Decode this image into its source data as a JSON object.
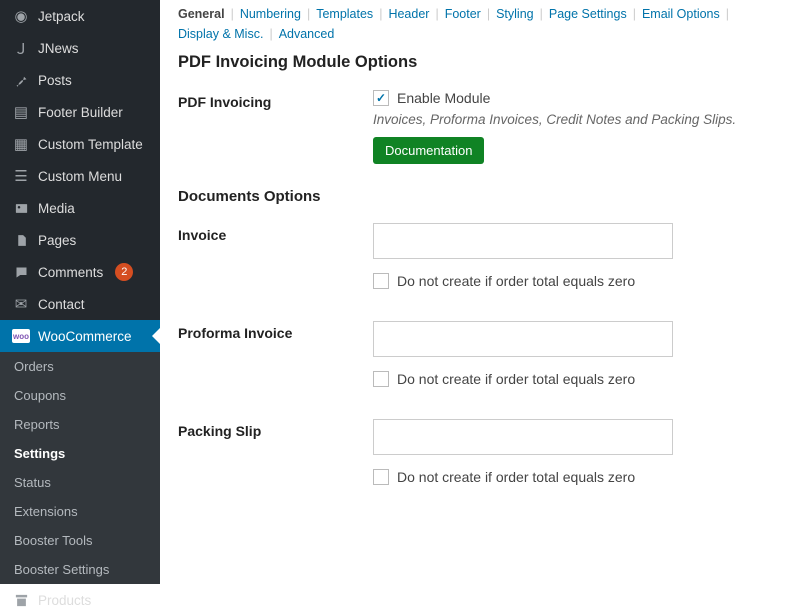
{
  "sidebar": {
    "items": [
      {
        "label": "Jetpack"
      },
      {
        "label": "JNews"
      },
      {
        "label": "Posts"
      },
      {
        "label": "Footer Builder"
      },
      {
        "label": "Custom Template"
      },
      {
        "label": "Custom Menu"
      },
      {
        "label": "Media"
      },
      {
        "label": "Pages"
      },
      {
        "label": "Comments",
        "badge": "2"
      },
      {
        "label": "Contact"
      },
      {
        "label": "WooCommerce"
      },
      {
        "label": "Products"
      }
    ],
    "sub": [
      {
        "label": "Orders"
      },
      {
        "label": "Coupons"
      },
      {
        "label": "Reports"
      },
      {
        "label": "Settings"
      },
      {
        "label": "Status"
      },
      {
        "label": "Extensions"
      },
      {
        "label": "Booster Tools"
      },
      {
        "label": "Booster Settings"
      }
    ]
  },
  "tabs": [
    "General",
    "Numbering",
    "Templates",
    "Header",
    "Footer",
    "Styling",
    "Page Settings",
    "Email Options",
    "Display & Misc.",
    "Advanced"
  ],
  "page": {
    "heading": "PDF Invoicing Module Options",
    "pdf_label": "PDF Invoicing",
    "enable_label": "Enable Module",
    "enable_checked": true,
    "desc": "Invoices, Proforma Invoices, Credit Notes and Packing Slips.",
    "doc_button": "Documentation",
    "docs_heading": "Documents Options",
    "rows": [
      {
        "label": "Invoice",
        "value": "",
        "zero_label": "Do not create if order total equals zero",
        "zero_checked": false
      },
      {
        "label": "Proforma Invoice",
        "value": "",
        "zero_label": "Do not create if order total equals zero",
        "zero_checked": false
      },
      {
        "label": "Packing Slip",
        "value": "",
        "zero_label": "Do not create if order total equals zero",
        "zero_checked": false
      }
    ]
  }
}
